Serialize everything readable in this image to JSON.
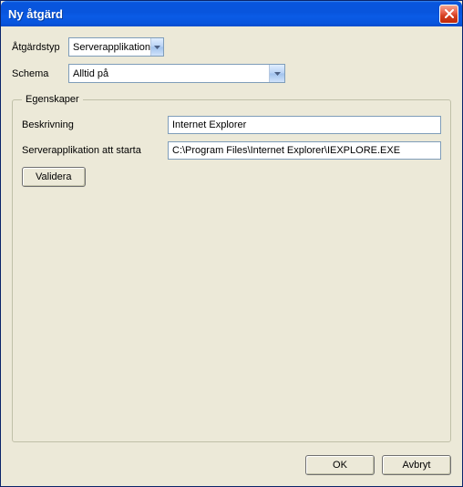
{
  "window": {
    "title": "Ny åtgärd"
  },
  "form": {
    "action_type_label": "Åtgärdstyp",
    "action_type_value": "Serverapplikation",
    "schema_label": "Schema",
    "schema_value": "Alltid på"
  },
  "group": {
    "legend": "Egenskaper",
    "description_label": "Beskrivning",
    "description_value": "Internet Explorer",
    "server_app_label": "Serverapplikation att starta",
    "server_app_value": "C:\\Program Files\\Internet Explorer\\IEXPLORE.EXE",
    "validate_label": "Validera"
  },
  "buttons": {
    "ok": "OK",
    "cancel": "Avbryt"
  }
}
